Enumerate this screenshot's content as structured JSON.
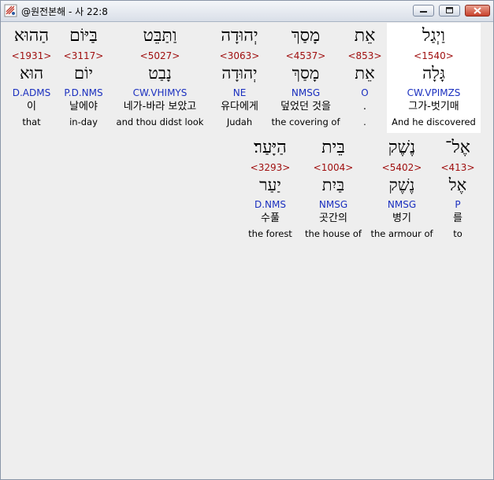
{
  "window": {
    "title": "@원전본해 - 사 22:8",
    "app_icon": "bible-app-icon",
    "buttons": {
      "minimize": "minimize-icon",
      "maximize": "maximize-icon",
      "close": "close-icon"
    }
  },
  "lines": [
    {
      "words": [
        {
          "hebrew": "וַיְגַל",
          "strong": "<1540>",
          "lemma": "גָּלָה",
          "parse": "CW.VPIMZS",
          "korean": "그가-벗기매",
          "english": "And he discovered",
          "selected": true
        },
        {
          "hebrew": "אֵת",
          "strong": "<853>",
          "lemma": "אֵת",
          "parse": "O",
          "korean": ".",
          "english": "."
        },
        {
          "hebrew": "מָסַךְ",
          "strong": "<4537>",
          "lemma": "מָסַךְ",
          "parse": "NMSG",
          "korean": "덮었던 것을",
          "english": "the covering of"
        },
        {
          "hebrew": "יְהוּדָה",
          "strong": "<3063>",
          "lemma": "יְהוּדָה",
          "parse": "NE",
          "korean": "유다에게",
          "english": "Judah"
        },
        {
          "hebrew": "וַתַּבֵּט",
          "strong": "<5027>",
          "lemma": "נָבַט",
          "parse": "CW.VHIMYS",
          "korean": "네가-바라 보았고",
          "english": "and thou didst look"
        },
        {
          "hebrew": "בַּיּוֹם",
          "strong": "<3117>",
          "lemma": "יוֹם",
          "parse": "P.D.NMS",
          "korean": "날에야",
          "english": "in-day"
        },
        {
          "hebrew": "הַהוּא",
          "strong": "<1931>",
          "lemma": "הוּא",
          "parse": "D.ADMS",
          "korean": "이",
          "english": "that"
        }
      ]
    },
    {
      "words": [
        {
          "hebrew": "אֶל־",
          "strong": "<413>",
          "lemma": "אֶל",
          "parse": "P",
          "korean": "를",
          "english": "to"
        },
        {
          "hebrew": "נֶשֶׁק",
          "strong": "<5402>",
          "lemma": "נֶשֶׁק",
          "parse": "NMSG",
          "korean": "병기",
          "english": "the armour of"
        },
        {
          "hebrew": "בֵּית",
          "strong": "<1004>",
          "lemma": "בַּיִת",
          "parse": "NMSG",
          "korean": "곳간의",
          "english": "the house of"
        },
        {
          "hebrew": "הַיָּעַר׃",
          "strong": "<3293>",
          "lemma": "יַעַר",
          "parse": "D.NMS",
          "korean": "수풀",
          "english": "the forest"
        }
      ]
    }
  ]
}
